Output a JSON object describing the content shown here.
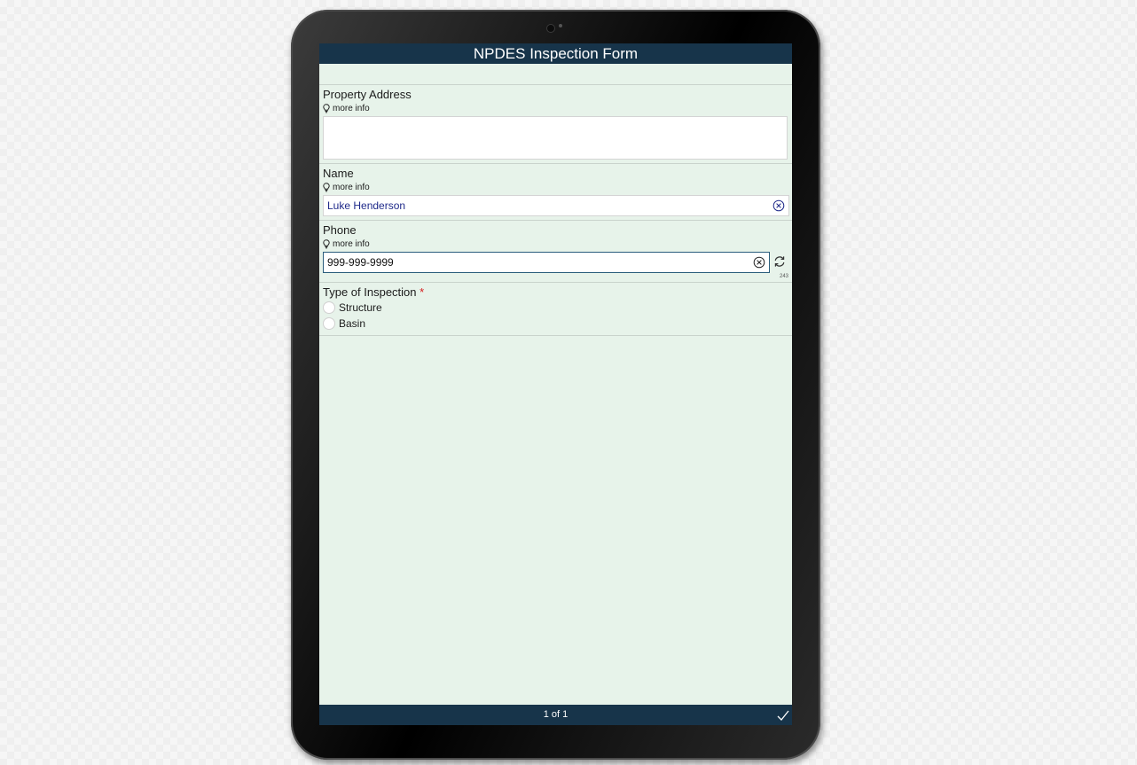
{
  "form": {
    "title": "NPDES Inspection Form",
    "questions": [
      {
        "label": "Property Address",
        "more_info": "more info",
        "value": ""
      },
      {
        "label": "Name",
        "more_info": "more info",
        "value": "Luke Henderson"
      },
      {
        "label": "Phone",
        "more_info": "more info",
        "value": "999-999-9999",
        "char_count": "243"
      },
      {
        "label": "Type of Inspection",
        "required_marker": "*",
        "options": [
          "Structure",
          "Basin"
        ]
      }
    ],
    "pagination": "1 of 1"
  },
  "colors": {
    "header": "#17344a",
    "background": "#e7f3ea",
    "required": "#d62020",
    "value_text": "#1f2a8a"
  },
  "icons": [
    "lightbulb-icon",
    "clear-icon",
    "refresh-icon",
    "checkmark-icon"
  ]
}
